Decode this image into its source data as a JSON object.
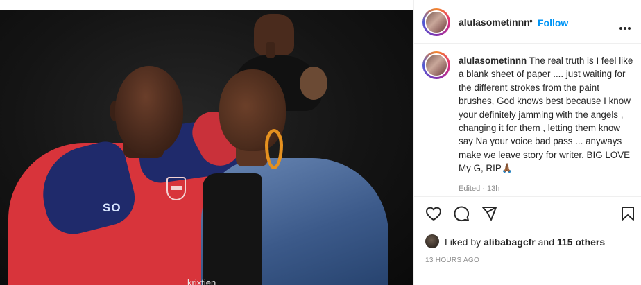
{
  "post": {
    "image_caption_overlay": "krixtien",
    "jersey_text": "SO"
  },
  "header": {
    "username": "alulasometinnn",
    "separator": "•",
    "follow_label": "Follow"
  },
  "comment": {
    "username": "alulasometinnn",
    "text": "The real truth is I feel like a blank sheet of paper .... just waiting for the different strokes from the paint brushes, God knows best because I know your definitely jamming with the angels , changing it for them , letting them know say Na your voice bad pass ... anyways make we leave story for writer. BIG LOVE My G, RIP🙏🏾",
    "meta": "Edited · 13h"
  },
  "actions": {
    "like_icon": "heart-icon",
    "comment_icon": "comment-icon",
    "share_icon": "send-icon",
    "save_icon": "bookmark-icon"
  },
  "likes": {
    "prefix": "Liked by",
    "user": "alibabagcfr",
    "joiner": "and",
    "others": "115 others"
  },
  "timestamp": "13 HOURS AGO",
  "colors": {
    "follow_blue": "#0095f6",
    "text": "#262626",
    "muted": "#8e8e8e",
    "border": "#efefef"
  }
}
